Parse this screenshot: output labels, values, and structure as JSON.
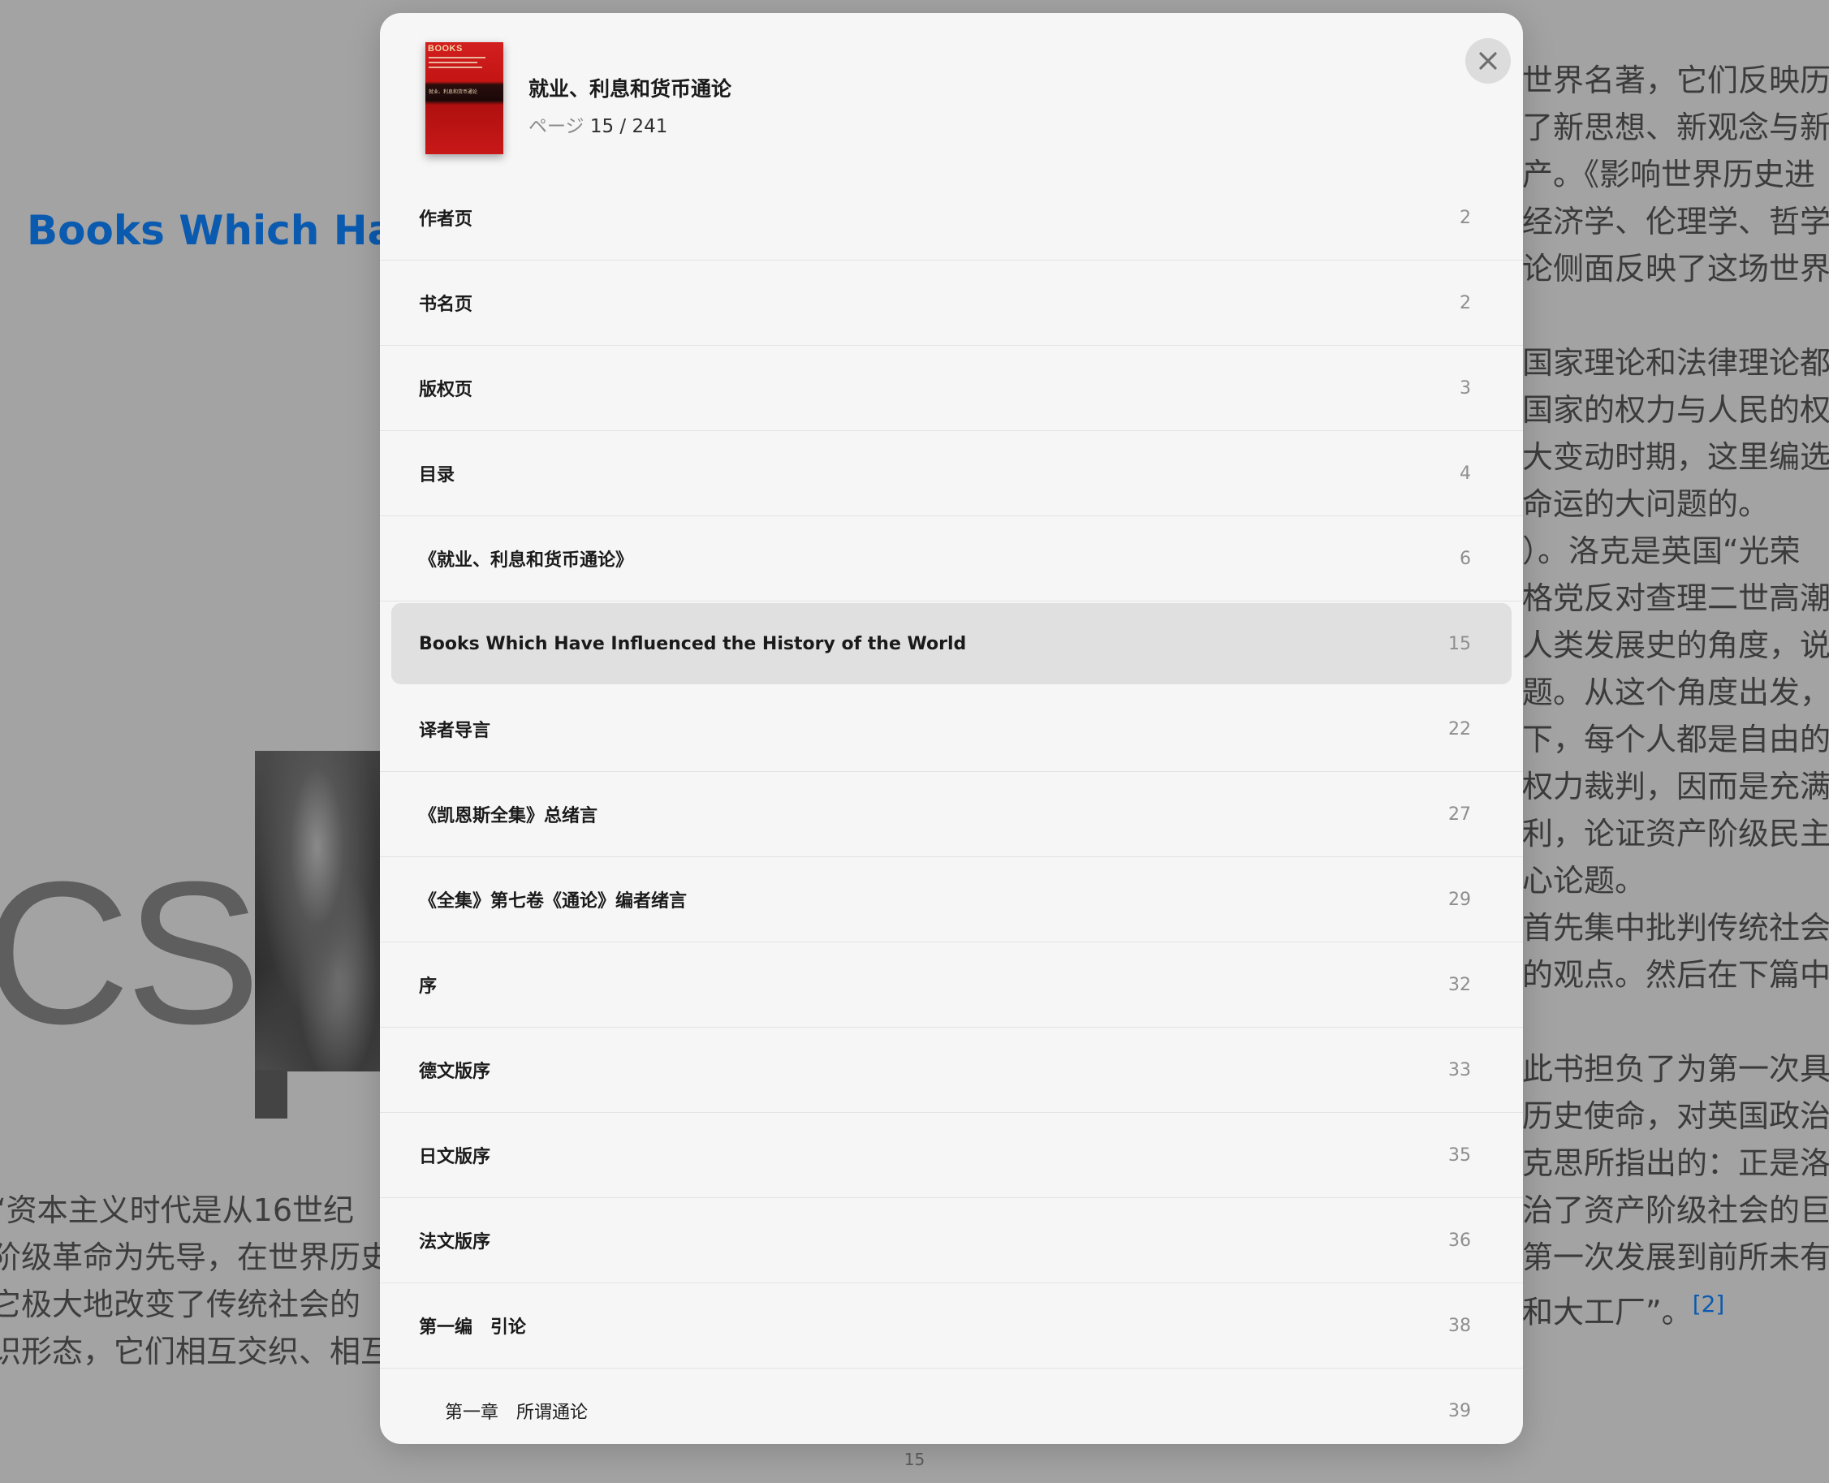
{
  "background_page": {
    "heading": "Books Which Have",
    "cover_text": "CS",
    "left_paragraph": [
      "  “资本主义时代是从16世纪",
      "阶级革命为先导，在世界历史",
      "  它极大地改变了传统社会的",
      "识形态，它们相互交织、相互"
    ],
    "right_lines": [
      "世界名著，它们反映历",
      "了新思想、新观念与新",
      "产。《影响世界历史进",
      "经济学、伦理学、哲学",
      "论侧面反映了这场世界",
      "",
      "国家理论和法律理论都",
      "国家的权力与人民的权",
      "大变动时期，这里编选",
      "命运的大问题的。",
      "）。洛克是英国“光荣",
      "格党反对查理二世高潮",
      "人类发展史的角度，说",
      "题。从这个角度出发，",
      "下，每个人都是自由的",
      "权力裁判，因而是充满",
      "利，论证资产阶级民主",
      "心论题。",
      "首先集中批判传统社会",
      "的观点。然后在下篇中",
      "",
      "此书担负了为第一次具",
      "历史使命，对英国政治",
      "克思所指出的：正是洛",
      "治了资产阶级社会的巨",
      "第一次发展到前所未有",
      "和大工厂”。"
    ],
    "footnote": "[2]",
    "page_number": "15"
  },
  "toc": {
    "book_title": "就业、利息和货币通论",
    "page_label": "ページ",
    "page_value": "15 / 241",
    "cover_brand": "BOOKS",
    "cover_title": "就业、利息和货币通论",
    "items": [
      {
        "label": "作者页",
        "page": "2"
      },
      {
        "label": "书名页",
        "page": "2"
      },
      {
        "label": "版权页",
        "page": "3"
      },
      {
        "label": "目录",
        "page": "4"
      },
      {
        "label": "《就业、利息和货币通论》",
        "page": "6"
      },
      {
        "label": "Books Which Have Influenced the History of the World",
        "page": "15"
      },
      {
        "label": "译者导言",
        "page": "22"
      },
      {
        "label": "《凯恩斯全集》总绪言",
        "page": "27"
      },
      {
        "label": "《全集》第七卷《通论》编者绪言",
        "page": "29"
      },
      {
        "label": "序",
        "page": "32"
      },
      {
        "label": "德文版序",
        "page": "33"
      },
      {
        "label": "日文版序",
        "page": "35"
      },
      {
        "label": "法文版序",
        "page": "36"
      },
      {
        "label": "第一编　引论",
        "page": "38"
      },
      {
        "label": "第一章　所谓通论",
        "page": "39"
      }
    ],
    "current_index": 5
  },
  "colors": {
    "link_blue": "#0a5ab0",
    "sheet_bg": "#f6f6f6",
    "highlight": "#e0e0e0"
  },
  "icons": {
    "close": "close-icon"
  }
}
